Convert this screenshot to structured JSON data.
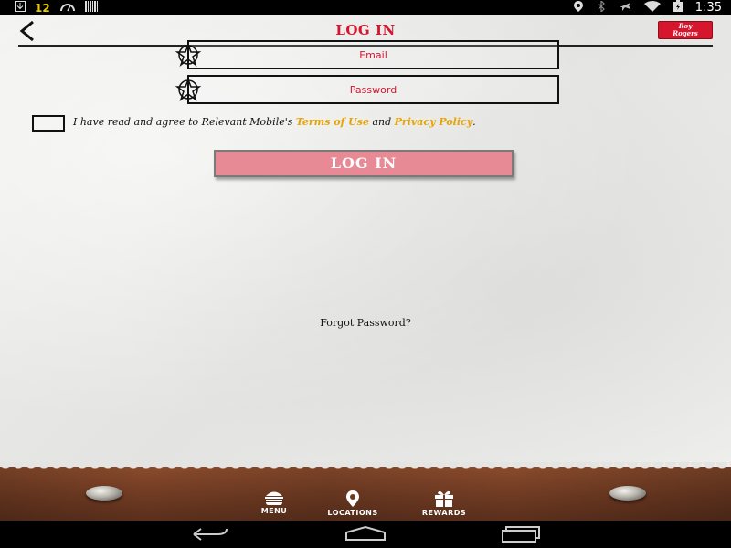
{
  "status_bar": {
    "left_icons": [
      "download-icon",
      "gas-icon",
      "speedometer-icon",
      "barcode-icon"
    ],
    "badge": "12",
    "right_icons": [
      "location-icon",
      "bluetooth-icon",
      "airplane-icon",
      "wifi-icon",
      "battery-icon"
    ],
    "time": "1:35"
  },
  "header": {
    "back_icon": "back-arrow-icon",
    "title": "LOG IN",
    "logo_line1": "Roy",
    "logo_line2": "Rogers"
  },
  "form": {
    "email_placeholder": "Email",
    "password_placeholder": "Password",
    "agree_prefix": "I have read and agree to Relevant Mobile's ",
    "terms_label": "Terms of Use",
    "agree_and": " and ",
    "privacy_label": "Privacy Policy",
    "agree_suffix": ".",
    "login_label": "LOG IN",
    "forgot_label": "Forgot Password?"
  },
  "bottom_nav": {
    "items": [
      {
        "label": "MENU",
        "icon": "burger-icon"
      },
      {
        "label": "LOCATIONS",
        "icon": "location-pin-icon"
      },
      {
        "label": "REWARDS",
        "icon": "gift-icon"
      }
    ]
  },
  "colors": {
    "accent_red": "#d5162d",
    "link_gold": "#e8a400",
    "login_button": "#e88a96"
  }
}
